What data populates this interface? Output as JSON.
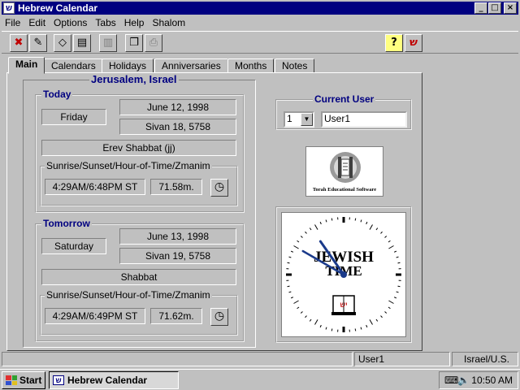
{
  "window": {
    "title": "Hebrew Calendar",
    "app_icon": "hebrew-calendar-app-icon",
    "controls": {
      "minimize": "_",
      "maximize": "□",
      "close": "×"
    }
  },
  "menu": [
    "File",
    "Edit",
    "Options",
    "Tabs",
    "Help",
    "Shalom"
  ],
  "menu_underlines": [
    "F",
    "E",
    "O",
    "T",
    "H",
    "S"
  ],
  "toolbar": {
    "icons": [
      "exit-icon",
      "search-icon",
      "erase-icon",
      "print-preview-icon",
      "book-icon",
      "copy-icon",
      "print-icon",
      "help-icon",
      "shalom-icon"
    ],
    "glyphs": [
      "✖",
      "✎",
      "◇",
      "▤",
      "▥",
      "❐",
      "⎙",
      "?",
      "ש"
    ]
  },
  "tabs": [
    "Main",
    "Calendars",
    "Holidays",
    "Anniversaries",
    "Months",
    "Notes"
  ],
  "main": {
    "location": "Jerusalem, Israel",
    "today": {
      "title": "Today",
      "weekday": "Friday",
      "gregorian": "June 12, 1998",
      "hebrew": "Sivan 18, 5758",
      "occasion": "Erev Shabbat (jj)",
      "zmanim_title": "Sunrise/Sunset/Hour-of-Time/Zmanim",
      "sun_times": "4:29AM/6:48PM ST",
      "hour_length": "71.58m."
    },
    "tomorrow": {
      "title": "Tomorrow",
      "weekday": "Saturday",
      "gregorian": "June 13, 1998",
      "hebrew": "Sivan 19, 5758",
      "occasion": "Shabbat",
      "zmanim_title": "Sunrise/Sunset/Hour-of-Time/Zmanim",
      "sun_times": "4:29AM/6:49PM ST",
      "hour_length": "71.62m."
    }
  },
  "current_user": {
    "title": "Current User",
    "number": "1",
    "name": "User1"
  },
  "logo": {
    "caption": "Torah Educational Software"
  },
  "clock": {
    "line1": "JEWISH",
    "line2": "TIME",
    "hour_hand_time": "10:50",
    "book_letters": "יש"
  },
  "status": {
    "left": "",
    "user": "User1",
    "region": "Israel/U.S."
  },
  "taskbar": {
    "start": "Start",
    "task": "Hebrew Calendar",
    "time": "10:50 AM"
  },
  "colors": {
    "title_bar": "#000080",
    "face": "#c0c0c0",
    "heading": "#000080",
    "desktop": "#008080"
  }
}
